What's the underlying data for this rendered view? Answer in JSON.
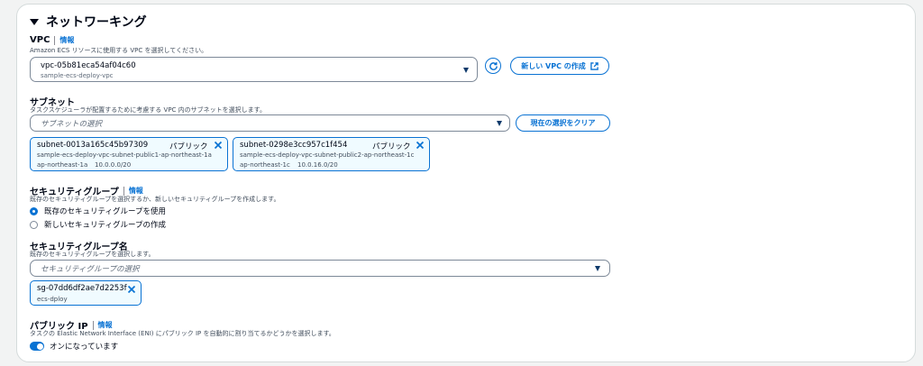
{
  "section": {
    "title": "ネットワーキング"
  },
  "vpc": {
    "label": "VPC",
    "info": "情報",
    "description": "Amazon ECS リソースに使用する VPC を選択してください。",
    "selected_id": "vpc-05b81eca54af04c60",
    "selected_name": "sample-ecs-deploy-vpc",
    "create_label": "新しい VPC の作成"
  },
  "subnet": {
    "label": "サブネット",
    "description": "タスクスケジューラが配置するために考慮する VPC 内のサブネットを選択します。",
    "placeholder": "サブネットの選択",
    "clear_label": "現在の選択をクリア",
    "tokens": [
      {
        "id": "subnet-0013a165c45b97309",
        "tag": "パブリック",
        "name": "sample-ecs-deploy-vpc-subnet-public1-ap-northeast-1a",
        "az": "ap-northeast-1a",
        "cidr": "10.0.0.0/20"
      },
      {
        "id": "subnet-0298e3cc957c1f454",
        "tag": "パブリック",
        "name": "sample-ecs-deploy-vpc-subnet-public2-ap-northeast-1c",
        "az": "ap-northeast-1c",
        "cidr": "10.0.16.0/20"
      }
    ]
  },
  "security_group": {
    "label": "セキュリティグループ",
    "info": "情報",
    "description": "既存のセキュリティグループを選択するか、新しいセキュリティグループを作成します。",
    "options": [
      "既存のセキュリティグループを使用",
      "新しいセキュリティグループの作成"
    ],
    "selected_index": 0
  },
  "security_group_name": {
    "label": "セキュリティグループ名",
    "description": "既存のセキュリティグループを選択します。",
    "placeholder": "セキュリティグループの選択",
    "token": {
      "id": "sg-07dd6df2ae7d2253f",
      "name": "ecs-dploy"
    }
  },
  "public_ip": {
    "label": "パブリック IP",
    "info": "情報",
    "description": "タスクの Elastic Network Interface (ENI) にパブリック IP を自動的に割り当てるかどうかを選択します。",
    "toggle_label": "オンになっています",
    "enabled": true
  },
  "colors": {
    "accent": "#0972d3",
    "border": "#7d8998",
    "token_bg": "#f0fbff"
  }
}
